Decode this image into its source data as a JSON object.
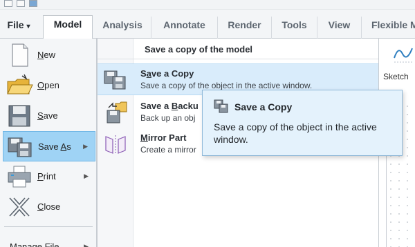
{
  "tabs": [
    {
      "label": "File",
      "arrow": "▾"
    },
    {
      "label": "Model"
    },
    {
      "label": "Analysis"
    },
    {
      "label": "Annotate"
    },
    {
      "label": "Render"
    },
    {
      "label": "Tools"
    },
    {
      "label": "View"
    },
    {
      "label": "Flexible M"
    }
  ],
  "file_menu": {
    "items": [
      {
        "label": "New",
        "mnemonic": "N",
        "rest": "ew"
      },
      {
        "label": "Open",
        "mnemonic": "O",
        "rest": "pen"
      },
      {
        "label": "Save",
        "mnemonic": "S",
        "rest": "ave"
      },
      {
        "label": "Save As",
        "pre": "Save ",
        "mnemonic": "A",
        "rest": "s",
        "arrow": "▶"
      },
      {
        "label": "Print",
        "mnemonic": "P",
        "rest": "rint",
        "arrow": "▶"
      },
      {
        "label": "Close",
        "mnemonic": "C",
        "rest": "lose"
      },
      {
        "label": "Manage File",
        "arrow": "▶"
      }
    ]
  },
  "submenu": {
    "header": "Save a copy of the model",
    "items": [
      {
        "title_pre": "S",
        "title_mn": "a",
        "title_rest": "ve a Copy",
        "desc": "Save a copy of the object in the active window."
      },
      {
        "title_pre": "Save a ",
        "title_mn": "B",
        "title_rest": "acku",
        "desc": "Back up an obj"
      },
      {
        "title_pre": "",
        "title_mn": "M",
        "title_rest": "irror Part",
        "desc": "Create a mirror"
      }
    ]
  },
  "tooltip": {
    "title": "Save a Copy",
    "description": "Save a copy of the object in the active window."
  },
  "background": {
    "sketch_label": "Sketch"
  }
}
